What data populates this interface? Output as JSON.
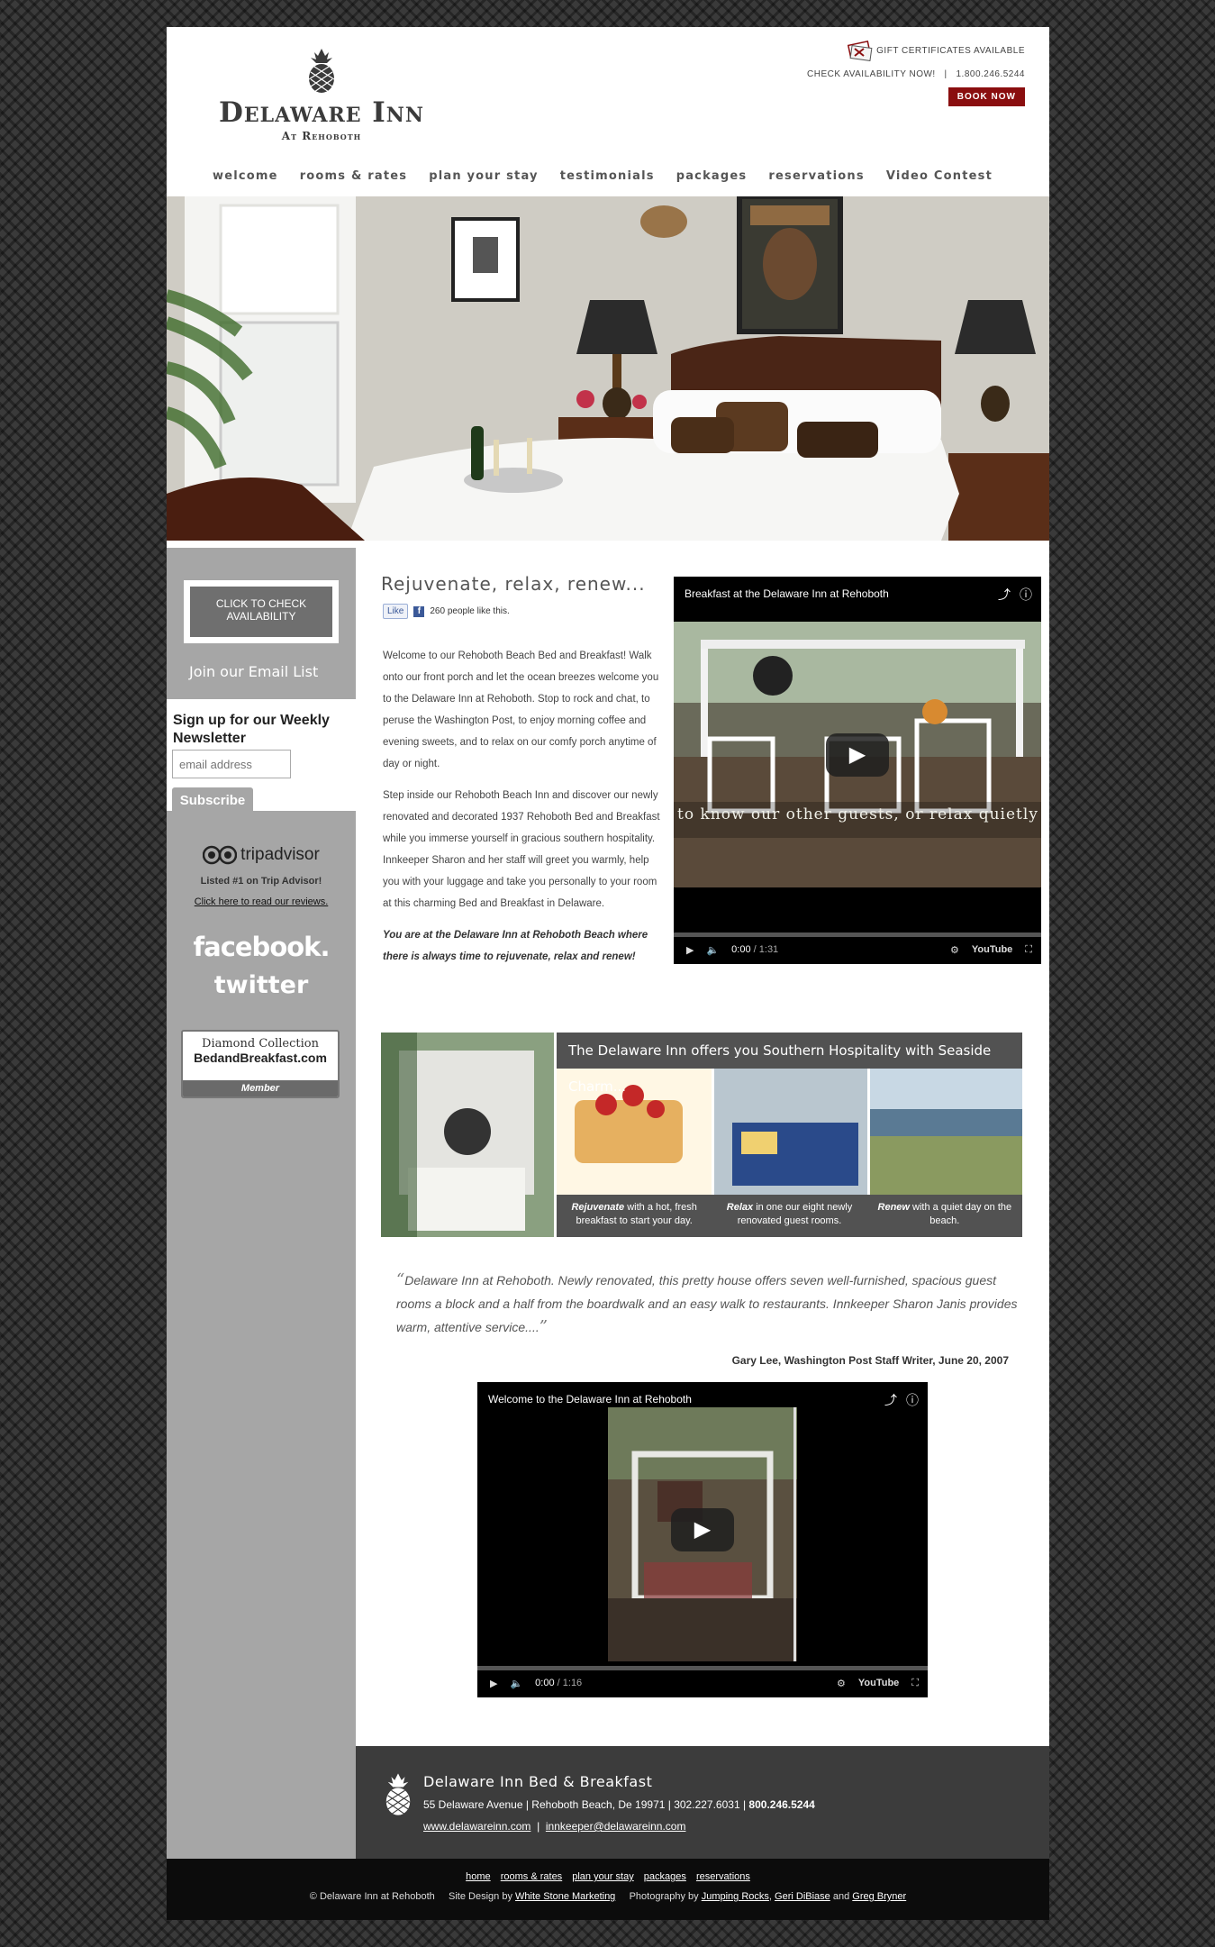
{
  "header": {
    "logo_name": "Delaware Inn",
    "logo_sub": "At Rehoboth",
    "gift": "GIFT CERTIFICATES AVAILABLE",
    "check": "CHECK AVAILABILITY NOW!",
    "phone": "1.800.246.5244",
    "book": "BOOK NOW"
  },
  "nav": [
    "welcome",
    "rooms & rates",
    "plan your stay",
    "testimonials",
    "packages",
    "reservations",
    "Video Contest"
  ],
  "sidebar": {
    "availability": "CLICK TO CHECK AVAILABILITY",
    "join": "Join our Email List",
    "signup_title": "Sign up for our Weekly Newsletter",
    "email_placeholder": "email address",
    "subscribe": "Subscribe",
    "tripadvisor": "tripadvisor",
    "listed": "Listed #1 on Trip Advisor!",
    "reviews_link": "Click here to read our reviews.",
    "facebook": "facebook.",
    "twitter": "twitter",
    "diamond_1": "Diamond Collection",
    "diamond_2": "BedandBreakfast.com",
    "diamond_3": "Member"
  },
  "content": {
    "title": "Rejuvenate, relax, renew...",
    "like": "Like",
    "like_count": "260 people like this.",
    "p1": "Welcome to our Rehoboth Beach Bed and Breakfast! Walk onto our front porch and let the ocean breezes welcome you to the Delaware Inn at Rehoboth. Stop to rock and chat, to peruse the Washington Post, to enjoy morning coffee and evening sweets, and to relax on our comfy porch anytime of day or night.",
    "p2": "Step inside our Rehoboth Beach Inn and discover our newly renovated and decorated 1937 Rehoboth Bed and Breakfast while you immerse yourself in gracious southern hospitality. Innkeeper Sharon and her staff will greet you warmly, help you with your luggage and take you personally to your room at this charming Bed and Breakfast in Delaware.",
    "p3": "You are at the Delaware Inn at Rehoboth Beach where there is always time to rejuvenate, relax and renew!"
  },
  "video1": {
    "title": "Breakfast at the Delaware Inn at Rehoboth",
    "caption": "to know our other guests, or relax quietly",
    "time": "0:00",
    "duration": "/ 1:31"
  },
  "promo": {
    "head": "The Delaware Inn offers you Southern Hospitality with Seaside Charm...",
    "cap1_b": "Rejuvenate",
    "cap1": "with a hot, fresh breakfast to start your day.",
    "cap2_b": "Relax",
    "cap2": "in one our eight newly renovated guest rooms.",
    "cap3_b": "Renew",
    "cap3": "with a quiet day on the beach."
  },
  "quote": {
    "text": "Delaware Inn at Rehoboth. Newly renovated, this pretty house offers seven well-furnished, spacious guest rooms a block and a half from the boardwalk and an easy walk to restaurants. Innkeeper Sharon Janis provides warm, attentive service....",
    "attribution": "Gary Lee, Washington Post Staff Writer, June 20, 2007"
  },
  "video2": {
    "title": "Welcome to the Delaware Inn at Rehoboth",
    "time": "0:00",
    "duration": "/ 1:16"
  },
  "footer": {
    "name": "Delaware Inn Bed & Breakfast",
    "address": "55 Delaware Avenue  |  Rehoboth Beach, De 19971  |  302.227.6031  |",
    "tollfree": "800.246.5244",
    "site": "www.delawareinn.com",
    "email": "innkeeper@delawareinn.com",
    "links": [
      "home",
      "rooms & rates",
      "plan your stay",
      "packages",
      "reservations"
    ],
    "copyright": "© Delaware Inn at Rehoboth",
    "design_prefix": "Site Design by",
    "designer": "White Stone Marketing",
    "photo_prefix": "Photography by",
    "photo1": "Jumping Rocks",
    "photo2": "Geri DiBiase",
    "photo_and": "and",
    "photo3": "Greg Bryner"
  }
}
